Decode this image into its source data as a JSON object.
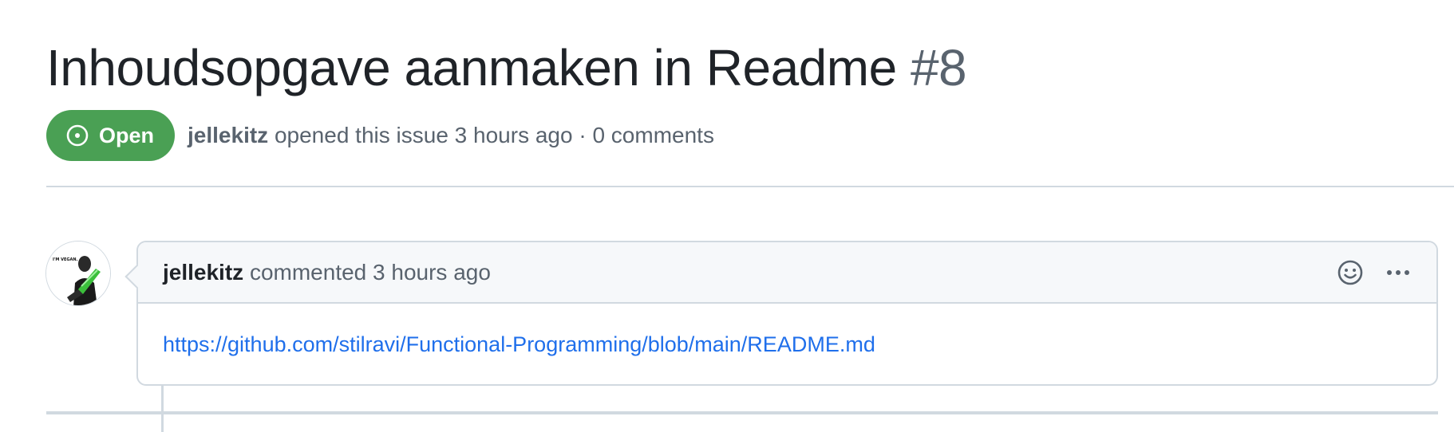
{
  "issue": {
    "title": "Inhoudsopgave aanmaken in Readme",
    "number": "#8",
    "state": "Open",
    "author": "jellekitz",
    "summary": "opened this issue 3 hours ago · 0 comments"
  },
  "comment": {
    "author": "jellekitz",
    "meta": "commented 3 hours ago",
    "link_text": "https://github.com/stilravi/Functional-Programming/blob/main/README.md",
    "avatar_text": "I'M VEGAN."
  },
  "icons": {
    "state": "issue-opened-icon",
    "reaction": "smiley-icon",
    "menu": "kebab-horizontal-icon"
  },
  "colors": {
    "open_badge": "#4aa054",
    "link": "#1f6feb",
    "muted": "#59636e",
    "border": "#d1d9e0",
    "header_bg": "#f6f8fa"
  }
}
